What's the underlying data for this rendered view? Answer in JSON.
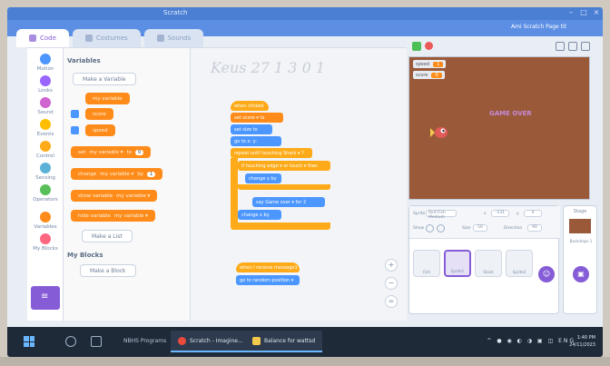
{
  "browser": {
    "title": "Scratch"
  },
  "menubar": {
    "right_label": "Ami Scratch   Page tit"
  },
  "tabs": [
    {
      "label": "Code"
    },
    {
      "label": "Costumes"
    },
    {
      "label": "Sounds"
    }
  ],
  "categories": [
    {
      "label": "Motion",
      "color": "#4c97ff"
    },
    {
      "label": "Looks",
      "color": "#9966ff"
    },
    {
      "label": "Sound",
      "color": "#cf63cf"
    },
    {
      "label": "Events",
      "color": "#ffbf00"
    },
    {
      "label": "Control",
      "color": "#ffab19"
    },
    {
      "label": "Sensing",
      "color": "#5cb1d6"
    },
    {
      "label": "Operators",
      "color": "#59c059"
    },
    {
      "label": "Variables",
      "color": "#ff8c1a"
    },
    {
      "label": "My Blocks",
      "color": "#ff6680"
    }
  ],
  "palette": {
    "variables_heading": "Variables",
    "make_variable": "Make a Variable",
    "var_my": "my variable",
    "var_score": "score",
    "var_speed": "speed",
    "set_block": "set",
    "set_var": "my variable ▾",
    "set_to": "to",
    "set_value": "0",
    "change_block": "change",
    "change_var": "my variable ▾",
    "change_by": "by",
    "change_value": "1",
    "show_var": "show variable",
    "show_var_name": "my variable ▾",
    "hide_var": "hide variable",
    "hide_var_name": "my variable ▾",
    "make_list": "Make a List",
    "myblocks_heading": "My Blocks",
    "make_block": "Make a Block"
  },
  "code": {
    "scribble": "Keus 27 1 3 0 1",
    "b1": "when clicked",
    "b2": "set score ▾ to",
    "b3": "set size to",
    "b4": "go to x: y:",
    "b5": "repeat until touching Shark ▾ ?",
    "b6": "if touching edge ▾ or touch ▾ then",
    "b7": "change y by",
    "b8": "say Game over ▾ for 2",
    "b9": "change x by",
    "b10": "when I receive message1 ▾",
    "b11": "go to random position ▾"
  },
  "stage": {
    "monitor_speed_label": "speed",
    "monitor_speed_value": "1",
    "monitor_score_label": "score",
    "monitor_score_value": "0",
    "game_over": "GAME OVER"
  },
  "sprite_info": {
    "sprite_label": "Sprite",
    "sprite_name": "Red Fish Medium",
    "x_label": "x",
    "x_value": "-131",
    "y_label": "y",
    "y_value": "0",
    "show_label": "Show",
    "size_label": "Size",
    "size_value": "50",
    "direction_label": "Direction",
    "direction_value": "90"
  },
  "sprites": [
    {
      "label": "Fish"
    },
    {
      "label": "Sprite1"
    },
    {
      "label": "Shark"
    },
    {
      "label": "Sprite2"
    }
  ],
  "stage_side": {
    "label": "Stage",
    "backdrops_label": "Backdrops 1"
  },
  "taskbar": {
    "search_text": "NBHS Programs",
    "task1": "Scratch - Imagine...",
    "task2": "Balance for wattsd",
    "tray": "^ ● ◉ ◐ ◑ ▣ ◫ ENG",
    "time": "1:40 PM",
    "date": "24/11/2023"
  }
}
